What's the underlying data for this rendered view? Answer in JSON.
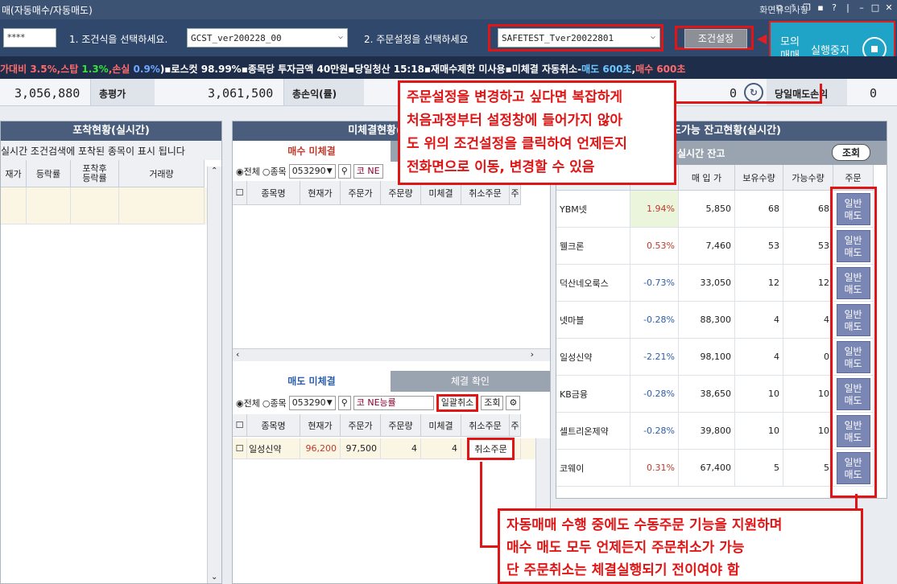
{
  "window": {
    "title": "매(자동매수/자동매도)",
    "caution": "화면유의사항"
  },
  "toolbar": {
    "password_mask": "****",
    "step1_label": "1. 조건식을 선택하세요.",
    "condition_value": "GCST_ver200228_00",
    "step2_label": "2. 주문설정을 선택하세요",
    "order_setting_value": "SAFETEST_Tver20022801",
    "cond_setting_button": "조건설정",
    "sim_label_1": "모의",
    "sim_label_2": "매매",
    "run_stop_label": "실행중지"
  },
  "infobar": {
    "segments": [
      {
        "text": "가대비 ",
        "color": "#ff6a6a"
      },
      {
        "text": "3.5%",
        "color": "#ff6a6a"
      },
      {
        "text": ",스탑 ",
        "color": "#ff6a6a"
      },
      {
        "text": "1.3%",
        "color": "#38e03a"
      },
      {
        "text": ",손실 ",
        "color": "#ff6a6a"
      },
      {
        "text": "0.9%",
        "color": "#6ea8ff"
      },
      {
        "text": ")▪로스컷 98.99%▪종목당 투자금액  40만원▪당일청산 15:18▪재매수제한 미사용▪미체결 자동취소-",
        "color": "#ffffff"
      },
      {
        "text": "매도 600초",
        "color": "#6ec8ff"
      },
      {
        "text": ",",
        "color": "#ffffff"
      },
      {
        "text": "매수 600초",
        "color": "#ff6a6a"
      }
    ]
  },
  "summary": {
    "val1": "3,056,880",
    "label_total": "총평가",
    "val_total": "3,061,500",
    "label_profit": "총손익(률)",
    "val_profit": "0",
    "label_daily": "당일매도손익",
    "val_daily": "0"
  },
  "capture_panel": {
    "title": "포착현황(실시간)",
    "subtitle": "실시간 조건검색에 포착된 종목이 표시 됩니다",
    "cols": [
      "재가",
      "등락률",
      "포착후 등락률",
      "거래량"
    ]
  },
  "unfilled_panel": {
    "title": "미체결현황(실시간)",
    "buy_tab": "매수 미체결",
    "sell_tab": "매도 미체결",
    "fill_tab": "체결 확인",
    "radio_all": "◉전체",
    "radio_one": "○종목",
    "code": "053290",
    "stock_name": "NE능률",
    "bulk_cancel": "일괄취소",
    "query": "조회",
    "cols": [
      "종목명",
      "현재가",
      "주문가",
      "주문량",
      "미체결",
      "취소주문",
      "주"
    ],
    "sell_rows": [
      {
        "name": "일성신약",
        "price": "96,200",
        "order_price": "97,500",
        "qty": "4",
        "unfilled": "4",
        "cancel": "취소주문"
      }
    ]
  },
  "holdings_panel": {
    "title": "매도가능 잔고현황(실시간)",
    "tab": "실시간 잔고",
    "query": "조회",
    "cols": [
      "",
      "매 입 가",
      "보유수량",
      "가능수량",
      "주문"
    ],
    "rows": [
      {
        "name": "YBM넷",
        "rate": "1.94%",
        "price": "5,850",
        "hold": "68",
        "avail": "68",
        "btn": "일반\n매도",
        "pos": true
      },
      {
        "name": "웰크론",
        "rate": "0.53%",
        "price": "7,460",
        "hold": "53",
        "avail": "53",
        "btn": "일반\n매도",
        "pos": true
      },
      {
        "name": "덕산네오룩스",
        "rate": "-0.73%",
        "price": "33,050",
        "hold": "12",
        "avail": "12",
        "btn": "일반\n매도",
        "pos": false
      },
      {
        "name": "넷마블",
        "rate": "-0.28%",
        "price": "88,300",
        "hold": "4",
        "avail": "4",
        "btn": "일반\n매도",
        "pos": false
      },
      {
        "name": "일성신약",
        "rate": "-2.21%",
        "price": "98,100",
        "hold": "4",
        "avail": "0",
        "btn": "일반\n매도",
        "pos": false
      },
      {
        "name": "KB금융",
        "rate": "-0.28%",
        "price": "38,650",
        "hold": "10",
        "avail": "10",
        "btn": "일반\n매도",
        "pos": false
      },
      {
        "name": "셀트리온제약",
        "rate": "-0.28%",
        "price": "39,800",
        "hold": "10",
        "avail": "10",
        "btn": "일반\n매도",
        "pos": false
      },
      {
        "name": "코웨이",
        "rate": "0.31%",
        "price": "67,400",
        "hold": "5",
        "avail": "5",
        "btn": "일반\n매도",
        "pos": true
      }
    ]
  },
  "annotations": {
    "top": [
      "주문설정을 변경하고 싶다면 복잡하게",
      "처음과정부터 설정창에 들어가지 않아",
      "도 위의 조건설정을 클릭하여 언제든지",
      "전화면으로 이동, 변경할 수 있음"
    ],
    "bottom": [
      "자동매매 수행 중에도 수동주문 기능을 지원하며",
      "매수 매도 모두 언제든지 주문취소가 가능",
      "단 주문취소는 체결실행되기 전이여야 함"
    ]
  }
}
